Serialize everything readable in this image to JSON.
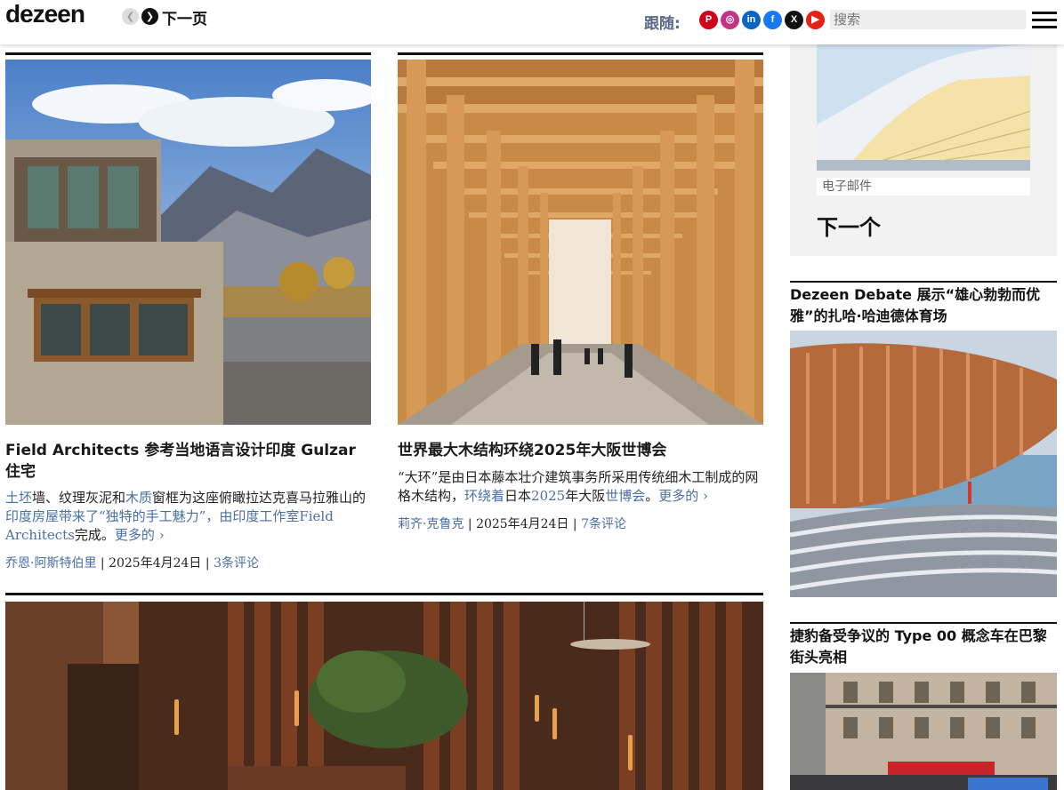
{
  "header": {
    "logo": "dezeen",
    "next_label": "下一页",
    "follow_label": "跟随:",
    "search_placeholder": "搜索",
    "socials": [
      {
        "name": "pinterest-icon",
        "glyph": "P",
        "color": "#d0021b"
      },
      {
        "name": "instagram-icon",
        "glyph": "◎",
        "color": "#c13584"
      },
      {
        "name": "linkedin-icon",
        "glyph": "in",
        "color": "#0a66c2"
      },
      {
        "name": "facebook-icon",
        "glyph": "f",
        "color": "#1877f2"
      },
      {
        "name": "x-icon",
        "glyph": "X",
        "color": "#111111"
      },
      {
        "name": "youtube-icon",
        "glyph": "▶",
        "color": "#e62117"
      }
    ]
  },
  "cards": [
    {
      "title": "Field Architects 参考当地语言设计印度 Gulzar 住宅",
      "excerpt_parts": [
        {
          "text": "土坯",
          "link": true
        },
        {
          "text": "墙、纹理灰泥和",
          "link": false
        },
        {
          "text": "木质",
          "link": true
        },
        {
          "text": "窗框为这座俯瞰拉达克喜马拉雅山的",
          "link": false
        },
        {
          "text": "印度房屋带来了“独特的手工魅力”，由印度工作室",
          "link": true
        },
        {
          "text": "Field Architects",
          "link": true
        },
        {
          "text": "完成。",
          "link": false
        },
        {
          "text": "更多的 ›",
          "link": true
        }
      ],
      "author": "乔恩·阿斯特伯里",
      "date": "2025年4月24日",
      "comments": "3条评论"
    },
    {
      "title": "世界最大木结构环绕2025年大阪世博会",
      "excerpt_parts": [
        {
          "text": "“大环”是由日本藤本壮介建筑事务所采用传统细木工制成的网格木结构，",
          "link": false
        },
        {
          "text": "环绕着",
          "link": true
        },
        {
          "text": "日本",
          "link": false
        },
        {
          "text": "2025",
          "link": true
        },
        {
          "text": "年大阪",
          "link": false
        },
        {
          "text": "世博会",
          "link": true
        },
        {
          "text": "。",
          "link": false
        },
        {
          "text": "更多的 ›",
          "link": true
        }
      ],
      "author": "莉齐·克鲁克",
      "date": "2025年4月24日",
      "comments": "7条评论"
    }
  ],
  "sidebar": {
    "email_placeholder": "电子邮件",
    "next_button": "下一个",
    "story1_title": "Dezeen Debate 展示“雄心勃勃而优雅”的扎哈·哈迪德体育场",
    "story2_title": "捷豹备受争议的 Type 00 概念车在巴黎街头亮相"
  },
  "colors": {
    "link": "#4a6fa5",
    "follow": "#5a6a8a",
    "sidebar_bg": "#f2f2f2"
  }
}
